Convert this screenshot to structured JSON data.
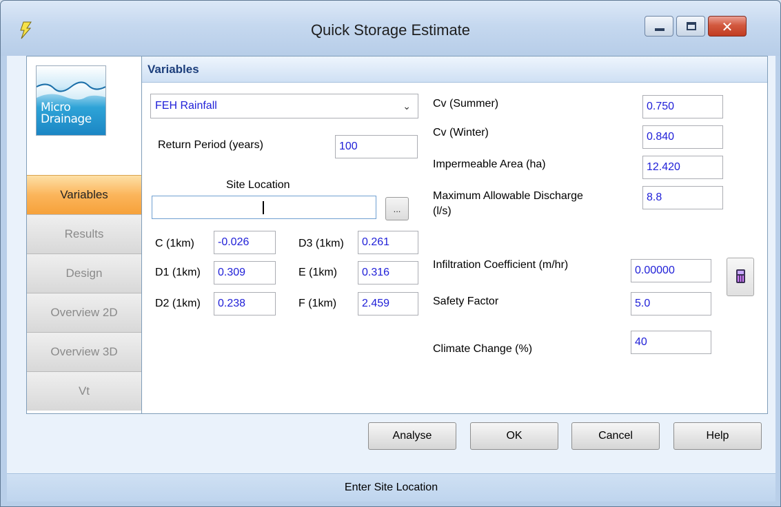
{
  "window": {
    "title": "Quick Storage Estimate",
    "controls": {
      "minimize": "minimize",
      "maximize": "maximize",
      "close": "✕"
    }
  },
  "logo": {
    "line1": "Micro",
    "line2": "Drainage"
  },
  "nav": {
    "items": [
      {
        "label": "Variables",
        "active": true
      },
      {
        "label": "Results",
        "active": false
      },
      {
        "label": "Design",
        "active": false
      },
      {
        "label": "Overview 2D",
        "active": false
      },
      {
        "label": "Overview 3D",
        "active": false
      },
      {
        "label": "Vt",
        "active": false
      }
    ]
  },
  "section_title": "Variables",
  "rainfall": {
    "selected": "FEH Rainfall"
  },
  "return_period": {
    "label": "Return Period (years)",
    "value": "100"
  },
  "site_location": {
    "label": "Site Location",
    "value": "",
    "browse_label": "..."
  },
  "feh": {
    "c_label": "C (1km)",
    "c_value": "-0.026",
    "d1_label": "D1 (1km)",
    "d1_value": "0.309",
    "d2_label": "D2 (1km)",
    "d2_value": "0.238",
    "d3_label": "D3 (1km)",
    "d3_value": "0.261",
    "e_label": "E (1km)",
    "e_value": "0.316",
    "f_label": "F (1km)",
    "f_value": "2.459"
  },
  "right": {
    "cv_summer_label": "Cv (Summer)",
    "cv_summer_value": "0.750",
    "cv_winter_label": "Cv (Winter)",
    "cv_winter_value": "0.840",
    "imp_area_label": "Impermeable Area (ha)",
    "imp_area_value": "12.420",
    "max_discharge_label_1": "Maximum Allowable Discharge",
    "max_discharge_label_2": "(l/s)",
    "max_discharge_value": "8.8",
    "infiltration_label": "Infiltration Coefficient (m/hr)",
    "infiltration_value": "0.00000",
    "safety_label": "Safety Factor",
    "safety_value": "5.0",
    "climate_label": "Climate Change (%)",
    "climate_value": "40"
  },
  "buttons": {
    "analyse": "Analyse",
    "ok": "OK",
    "cancel": "Cancel",
    "help": "Help"
  },
  "status": "Enter Site Location",
  "colors": {
    "value_text": "#2020d8",
    "active_tab": "#f6a13a",
    "header_text": "#1d3f7c"
  }
}
